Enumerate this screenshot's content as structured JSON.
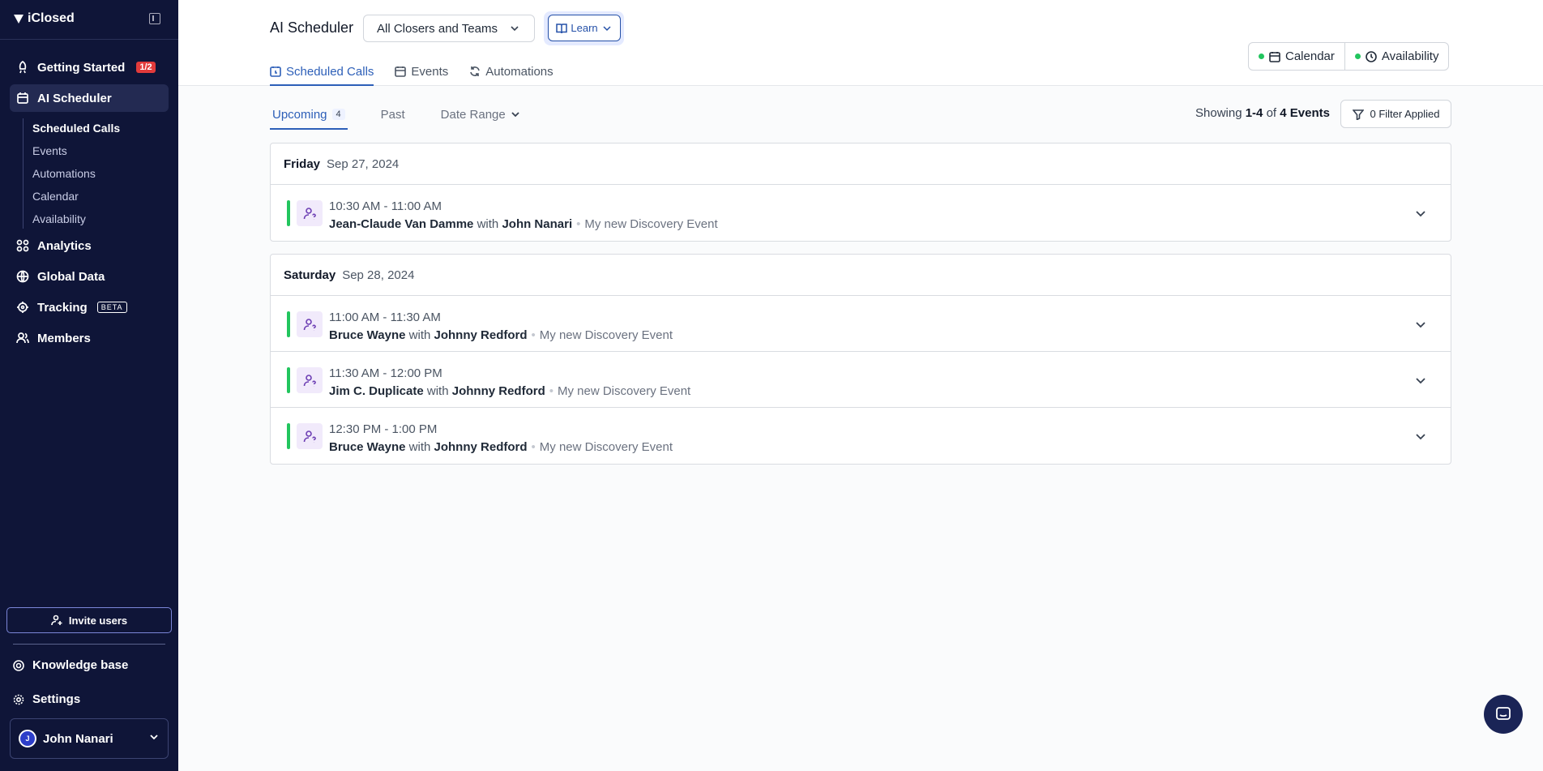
{
  "brand": {
    "name": "iClosed"
  },
  "sidebar": {
    "nav": [
      {
        "label": "Getting Started",
        "badge": "1/2"
      },
      {
        "label": "AI Scheduler"
      },
      {
        "label": "Analytics"
      },
      {
        "label": "Global Data"
      },
      {
        "label": "Tracking",
        "badge": "BETA"
      },
      {
        "label": "Members"
      }
    ],
    "subnav": [
      "Scheduled Calls",
      "Events",
      "Automations",
      "Calendar",
      "Availability"
    ],
    "invite_label": "Invite users",
    "knowledge_base": "Knowledge base",
    "settings": "Settings",
    "user": {
      "initial": "J",
      "name": "John Nanari"
    }
  },
  "header": {
    "title": "AI Scheduler",
    "selector_value": "All Closers and Teams",
    "learn_label": "Learn",
    "tabs": [
      "Scheduled Calls",
      "Events",
      "Automations"
    ],
    "calendar_label": "Calendar",
    "availability_label": "Availability"
  },
  "subtabs": {
    "upcoming": "Upcoming",
    "upcoming_count": "4",
    "past": "Past",
    "date_range": "Date Range"
  },
  "showing": {
    "prefix": "Showing",
    "range": "1-4",
    "of": "of",
    "total": "4 Events"
  },
  "filter_label": "0 Filter Applied",
  "groups": [
    {
      "day": "Friday",
      "date": "Sep 27, 2024",
      "events": [
        {
          "time": "10:30 AM - 11:00 AM",
          "lead": "Jean-Claude Van Damme",
          "with": "with",
          "closer": "John Nanari",
          "event": "My new Discovery Event"
        }
      ]
    },
    {
      "day": "Saturday",
      "date": "Sep 28, 2024",
      "events": [
        {
          "time": "11:00 AM - 11:30 AM",
          "lead": "Bruce Wayne",
          "with": "with",
          "closer": "Johnny Redford",
          "event": "My new Discovery Event"
        },
        {
          "time": "11:30 AM - 12:00 PM",
          "lead": "Jim C. Duplicate",
          "with": "with",
          "closer": "Johnny Redford",
          "event": "My new Discovery Event"
        },
        {
          "time": "12:30 PM - 1:00 PM",
          "lead": "Bruce Wayne",
          "with": "with",
          "closer": "Johnny Redford",
          "event": "My new Discovery Event"
        }
      ]
    }
  ],
  "colors": {
    "sidebar_bg": "#0f1538",
    "accent": "#2d5fb8",
    "status_green": "#22c55e",
    "badge_red": "#e23b3b"
  }
}
